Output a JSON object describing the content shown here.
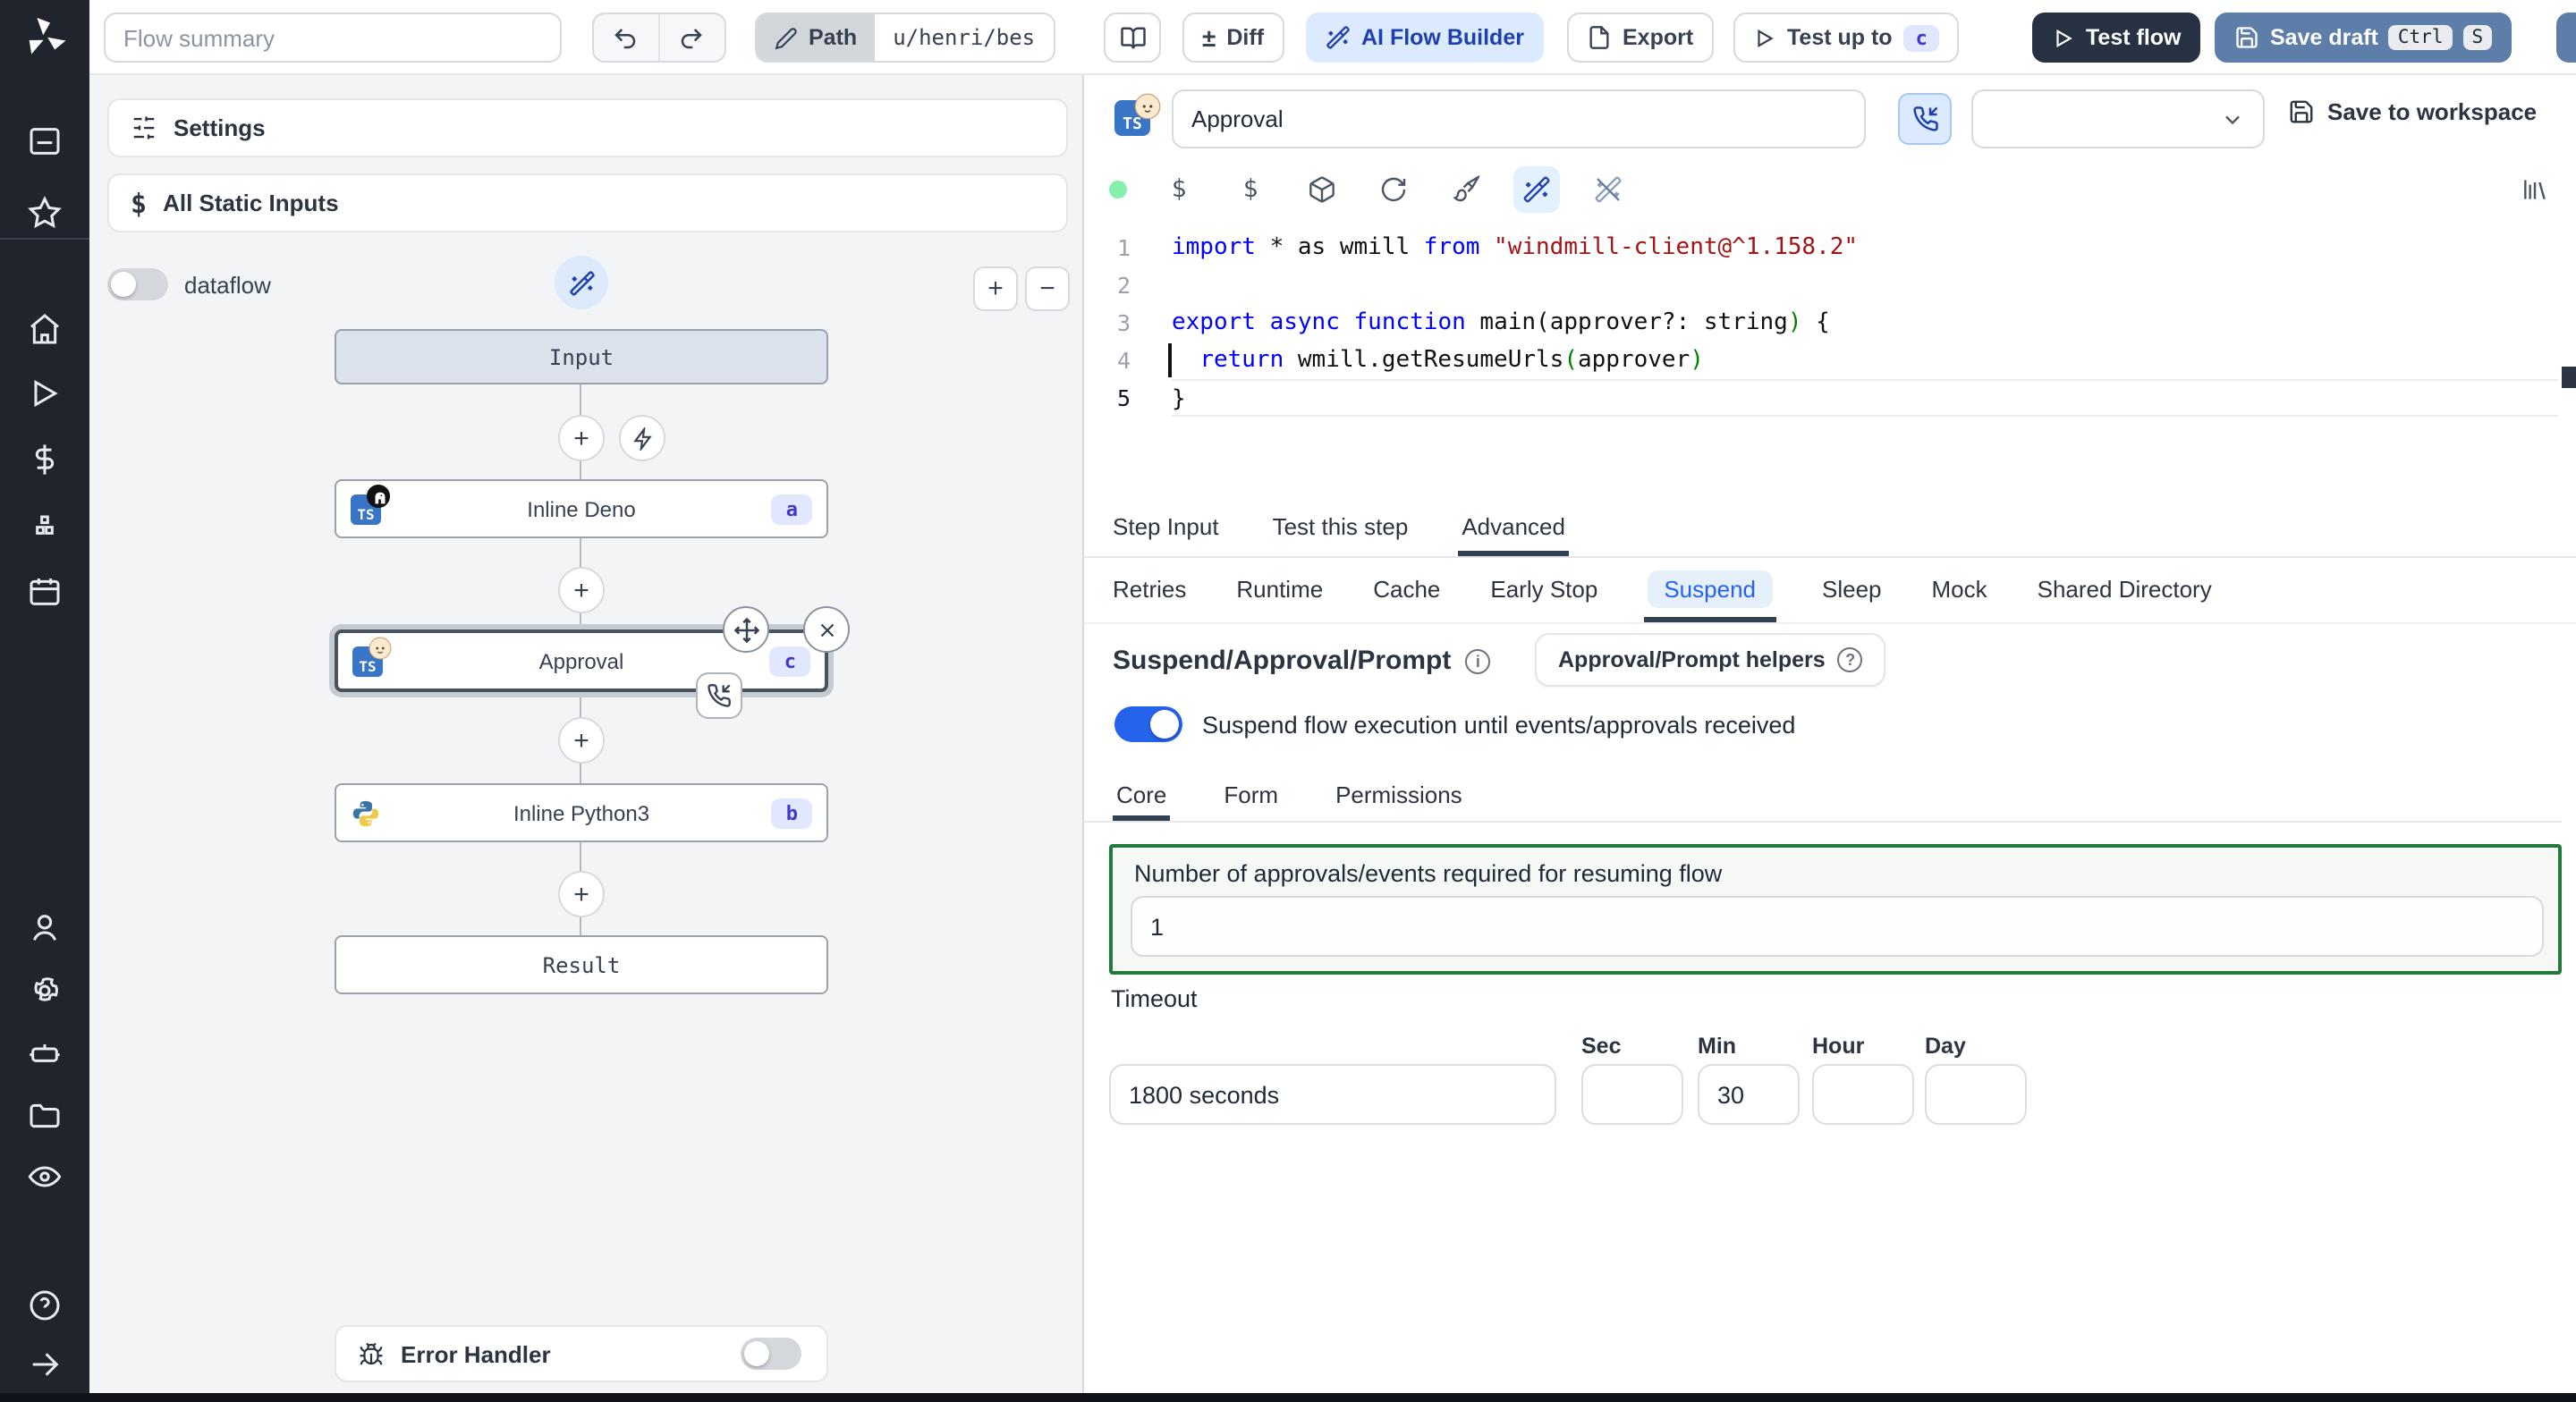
{
  "colors": {
    "accent": "#2563eb",
    "sidebar_bg": "#20242d",
    "ai_btn_bg": "#dbeafe",
    "ai_btn_text": "#1e40af",
    "test_flow_bg": "#273142",
    "save_draft_bg": "#5d7ea8",
    "badge_bg": "#e0e7ff",
    "badge_text": "#4338ca",
    "toggle_on": "#2563eb",
    "green_border": "#217a3c",
    "green_bg": "#f5f8f5",
    "code_keyword": "#0000ff",
    "code_string": "#a31515",
    "code_paren": "#008000",
    "status_dot": "#86efac"
  },
  "icons": {
    "plus": "+",
    "minus": "−",
    "dollar": "$",
    "diff": "±",
    "info": "i",
    "help": "?",
    "ts": "TS"
  },
  "topbar": {
    "flow_summary_placeholder": "Flow summary",
    "path_label": "Path",
    "path_value": "u/henri/bes",
    "diff_label": "Diff",
    "ai_flow_builder_label": "AI Flow Builder",
    "export_label": "Export",
    "test_up_to_label": "Test up to",
    "test_up_to_badge": "c",
    "test_flow_label": "Test flow",
    "save_draft_label": "Save draft",
    "kbd_ctrl": "Ctrl",
    "kbd_s": "S"
  },
  "flow_panel": {
    "settings_label": "Settings",
    "static_inputs_label": "All Static Inputs",
    "dataflow_label": "dataflow",
    "error_handler_label": "Error Handler",
    "graph": {
      "input_label": "Input",
      "result_label": "Result",
      "steps": [
        {
          "label": "Inline Deno",
          "badge": "a"
        },
        {
          "label": "Approval",
          "badge": "c"
        },
        {
          "label": "Inline Python3",
          "badge": "b"
        }
      ]
    }
  },
  "step_panel": {
    "title_value": "Approval",
    "save_to_workspace_label": "Save to workspace",
    "tabs": [
      "Step Input",
      "Test this step",
      "Advanced"
    ],
    "active_tab": "Advanced",
    "subtabs": [
      "Retries",
      "Runtime",
      "Cache",
      "Early Stop",
      "Suspend",
      "Sleep",
      "Mock",
      "Shared Directory"
    ],
    "active_subtab": "Suspend",
    "editor": {
      "active_line": 5,
      "lines": [
        [
          [
            "kw",
            "import"
          ],
          [
            "pl",
            " * as wmill "
          ],
          [
            "kw",
            "from"
          ],
          [
            "str",
            " \"windmill-client@^1.158.2\""
          ]
        ],
        [],
        [
          [
            "kw",
            "export"
          ],
          [
            "pl",
            " "
          ],
          [
            "kw",
            "async"
          ],
          [
            "pl",
            " "
          ],
          [
            "kw",
            "function"
          ],
          [
            "pl",
            " main(approver?: string"
          ],
          [
            "grn",
            ")"
          ],
          [
            "pl",
            " {"
          ]
        ],
        [
          [
            "pl",
            "  "
          ],
          [
            "kw",
            "return"
          ],
          [
            "pl",
            " wmill.getResumeUrls"
          ],
          [
            "grn",
            "("
          ],
          [
            "pl",
            "approver"
          ],
          [
            "grn",
            ")"
          ]
        ],
        [
          [
            "pl",
            "}"
          ]
        ]
      ]
    },
    "suspend": {
      "heading": "Suspend/Approval/Prompt",
      "helpers_button_label": "Approval/Prompt helpers",
      "toggle_label": "Suspend flow execution until events/approvals received",
      "tabs": [
        "Core",
        "Form",
        "Permissions"
      ],
      "active_tab": "Core",
      "approvals_label": "Number of approvals/events required for resuming flow",
      "approvals_value": "1",
      "timeout_label": "Timeout",
      "timeout_value": "1800 seconds",
      "unit_labels": [
        "Sec",
        "Min",
        "Hour",
        "Day"
      ],
      "unit_values": [
        "",
        "30",
        "",
        ""
      ]
    }
  }
}
